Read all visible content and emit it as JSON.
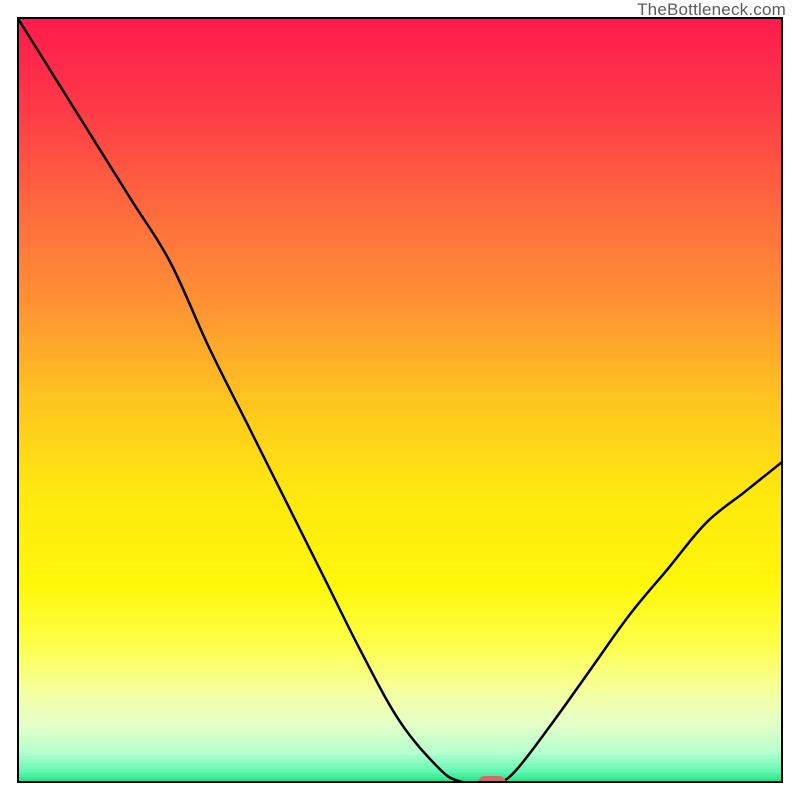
{
  "watermark": "TheBottleneck.com",
  "marker_color": "#ce6b6d",
  "curve_color": "#000000",
  "chart_data": {
    "type": "line",
    "title": "",
    "xlabel": "",
    "ylabel": "",
    "xlim": [
      0,
      100
    ],
    "ylim": [
      0,
      100
    ],
    "x": [
      0,
      5,
      10,
      15,
      20,
      25,
      30,
      35,
      40,
      45,
      50,
      55,
      57.5,
      60,
      62.5,
      65,
      70,
      75,
      80,
      85,
      90,
      95,
      100
    ],
    "values": [
      100,
      92,
      84,
      76,
      68,
      57,
      47,
      37,
      27,
      17,
      8,
      2,
      0.3,
      0,
      0,
      1.5,
      8,
      15,
      22,
      28,
      34,
      38,
      42
    ],
    "marker": {
      "x": 62,
      "y": 0
    },
    "background_gradient": [
      {
        "pos": 0.0,
        "color": "#ff1a4d"
      },
      {
        "pos": 0.12,
        "color": "#ff3a47"
      },
      {
        "pos": 0.25,
        "color": "#ff6a3e"
      },
      {
        "pos": 0.38,
        "color": "#ff9433"
      },
      {
        "pos": 0.5,
        "color": "#ffc51f"
      },
      {
        "pos": 0.62,
        "color": "#ffe80f"
      },
      {
        "pos": 0.74,
        "color": "#fff70a"
      },
      {
        "pos": 0.82,
        "color": "#fdff4a"
      },
      {
        "pos": 0.88,
        "color": "#f4ff9e"
      },
      {
        "pos": 0.92,
        "color": "#e6ffc6"
      },
      {
        "pos": 0.96,
        "color": "#b6ffd0"
      },
      {
        "pos": 0.985,
        "color": "#60f7b0"
      },
      {
        "pos": 1.0,
        "color": "#18e07e"
      }
    ]
  }
}
